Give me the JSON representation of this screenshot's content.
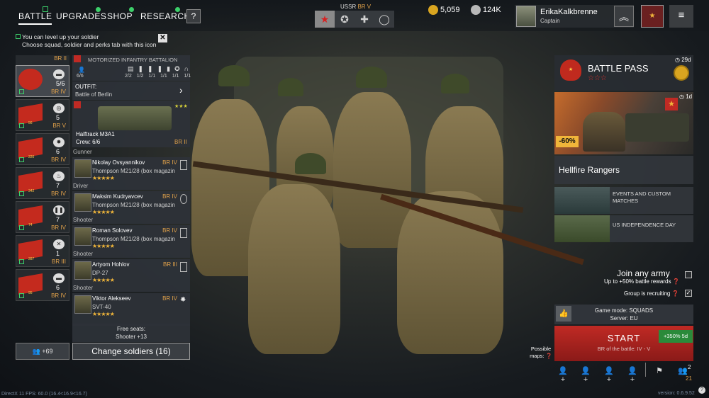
{
  "nav": {
    "items": [
      {
        "label": "BATTLE"
      },
      {
        "label": "UPGRADES"
      },
      {
        "label": "SHOP"
      },
      {
        "label": "RESEARCH"
      }
    ],
    "help": "?"
  },
  "army": {
    "nation": "USSR",
    "br": "BR V"
  },
  "currency": {
    "gold": "5,059",
    "silver": "124K"
  },
  "profile": {
    "name": "ErikaKalkbrenne",
    "rank": "Captain"
  },
  "notification": {
    "line1": "You can level up your soldier",
    "line2": "Choose squad, soldier and perks tab with this icon",
    "close": "✕"
  },
  "squads": [
    {
      "count": "5/6",
      "br": "BR IV",
      "level": ""
    },
    {
      "count": "5",
      "br": "BR V",
      "level": "56"
    },
    {
      "count": "6",
      "br": "BR IV",
      "level": "220"
    },
    {
      "count": "7",
      "br": "BR IV",
      "level": "342"
    },
    {
      "count": "7",
      "br": "BR IV",
      "level": "74"
    },
    {
      "count": "1",
      "br": "BR III",
      "level": "287"
    },
    {
      "count": "6",
      "br": "BR IV",
      "level": "95"
    }
  ],
  "squad_top_br": "BR II",
  "unit": {
    "title": "MOTORIZED INFANTRY BATTALION",
    "crew": "6/6",
    "stats": [
      "2/2",
      "1/2",
      "1/1",
      "1/1",
      "1/1",
      "1/1"
    ],
    "outfit_label": "OUTFIT:",
    "outfit_value": "Battle of Berlin",
    "vehicle_name": "Halftrack M3A1",
    "vehicle_crew": "Crew: 6/6",
    "vehicle_br": "BR II",
    "vehicle_stars": "★★★"
  },
  "soldiers": [
    {
      "role": "Gunner",
      "name": "Nikolay Ovsyannikov",
      "weapon": "Thompson M21/28 (box magazin",
      "br": "BR IV",
      "stars": "★★★★★"
    },
    {
      "role": "Driver",
      "name": "Maksim Kudryavcev",
      "weapon": "Thompson M21/28 (box magazin",
      "br": "BR IV",
      "stars": "★★★★★"
    },
    {
      "role": "Shooter",
      "name": "Roman Solovev",
      "weapon": "Thompson M21/28 (box magazin",
      "br": "BR IV",
      "stars": "★★★★★"
    },
    {
      "role": "Shooter",
      "name": "Artyom Hohlov",
      "weapon": "DP-27",
      "br": "BR III",
      "stars": "★★★★★"
    },
    {
      "role": "Shooter",
      "name": "Viktor Alekseev",
      "weapon": "SVT-40",
      "br": "BR IV",
      "stars": "★★★★★"
    }
  ],
  "free_seats": {
    "label": "Free seats:",
    "value": "Shooter +13"
  },
  "change_soldiers": "Change soldiers (16)",
  "friends": "+69",
  "battle_pass": {
    "title": "BATTLE PASS",
    "days": "29d",
    "stars": "☆☆☆"
  },
  "promo": {
    "days": "1d",
    "discount": "-60%",
    "title": "Hellfire Rangers"
  },
  "events": [
    {
      "label": "EVENTS AND CUSTOM MATCHES"
    },
    {
      "label": "US INDEPENDENCE DAY"
    }
  ],
  "join_army": {
    "title": "Join any army",
    "subtitle": "Up to +50% battle rewards",
    "recruiting": "Group is recruiting"
  },
  "game": {
    "mode": "Game mode: SQUADS",
    "server": "Server: EU"
  },
  "start": {
    "label": "START",
    "br": "BR of the battle: IV - V",
    "bonus": "+350% 5d"
  },
  "maps": {
    "label": "Possible maps:"
  },
  "bottom": {
    "group_count": "2",
    "group_count2": "21"
  },
  "footer": {
    "left": "DirectX 11 FPS: 60.0 (16.4<16.9<16.7)",
    "right": "version: 0.6.9.52"
  },
  "colors": {
    "accent_red": "#c02a24",
    "br": "#e0a14a",
    "star": "#f0b53a",
    "online": "#3cd06a"
  }
}
